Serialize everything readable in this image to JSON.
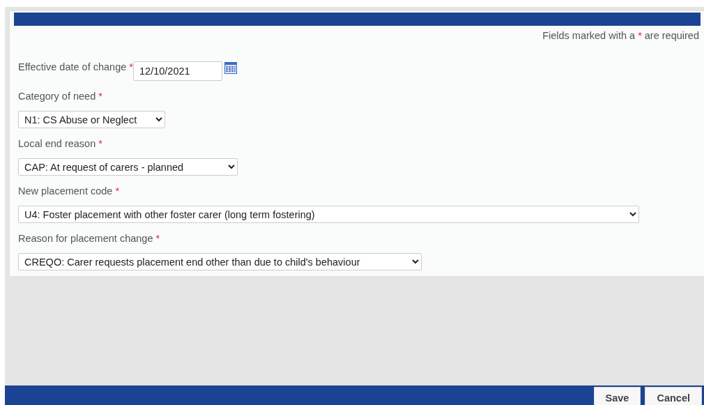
{
  "notice": {
    "before": "Fields marked with a",
    "mark": "*",
    "after": "are required"
  },
  "fields": [
    {
      "kind": "date",
      "label": "Effective date of change",
      "required": true,
      "value": "12/10/2021"
    },
    {
      "kind": "select",
      "label": "Category of need",
      "required": true,
      "value": "N1: CS Abuse or Neglect"
    },
    {
      "kind": "select",
      "label": "Local end reason",
      "required": true,
      "value": "CAP: At request of carers - planned"
    },
    {
      "kind": "select",
      "label": "New placement code",
      "required": true,
      "value": "U4: Foster placement with other foster carer (long term fostering)"
    },
    {
      "kind": "select",
      "label": "Reason for placement change",
      "required": true,
      "value": "CREQO: Carer requests placement end other than due to child's behaviour"
    }
  ],
  "buttons": [
    "Save",
    "Cancel"
  ]
}
